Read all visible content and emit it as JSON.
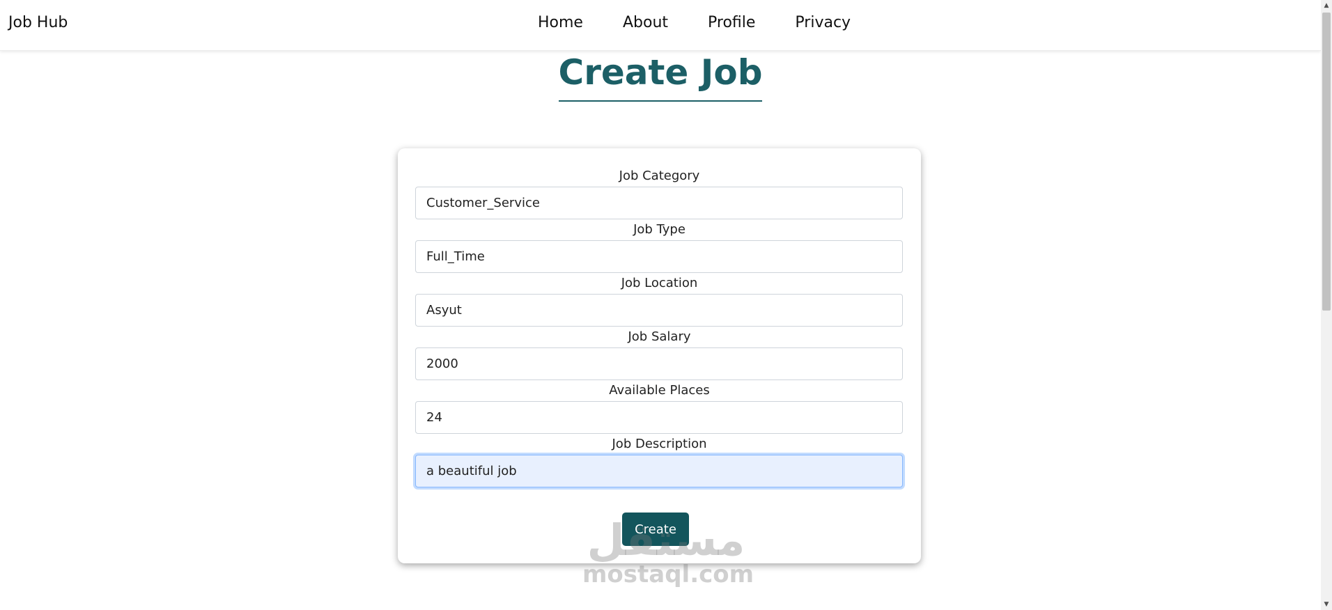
{
  "navbar": {
    "brand": "Job Hub",
    "links": [
      "Home",
      "About",
      "Profile",
      "Privacy"
    ]
  },
  "page": {
    "title": "Create Job",
    "title_color": "#1c5f66"
  },
  "form": {
    "fields": [
      {
        "label": "Job Category",
        "value": "Customer_Service"
      },
      {
        "label": "Job Type",
        "value": "Full_Time"
      },
      {
        "label": "Job Location",
        "value": "Asyut"
      },
      {
        "label": "Job Salary",
        "value": "2000"
      },
      {
        "label": "Available Places",
        "value": "24"
      },
      {
        "label": "Job Description",
        "value": "a beautiful job"
      }
    ],
    "submit_label": "Create",
    "submit_color": "#13555c"
  },
  "watermark": {
    "arabic": "مستقل",
    "latin": "mostaql.com"
  },
  "scrollbar": {
    "up_icon": "scroll-up-arrow-icon",
    "down_icon": "scroll-down-arrow-icon"
  }
}
